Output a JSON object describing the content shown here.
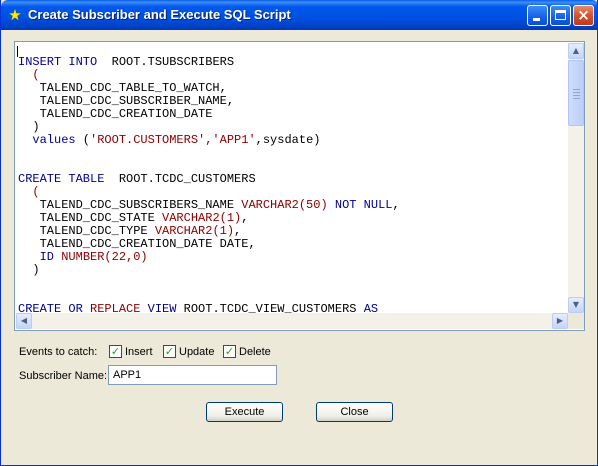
{
  "window": {
    "title": "Create Subscriber and Execute SQL Script",
    "icon": "star-icon",
    "controls": {
      "minimize": "minimize-icon",
      "maximize": "maximize-icon",
      "close": "×"
    }
  },
  "sql_script": {
    "lines": [
      [
        {
          "t": "INSERT INTO",
          "c": "kw"
        },
        {
          "t": "  ROOT.TSUBSCRIBERS"
        }
      ],
      [
        {
          "t": "  (",
          "c": "ty"
        }
      ],
      [
        {
          "t": "   TALEND_CDC_TABLE_TO_WATCH,"
        }
      ],
      [
        {
          "t": "   TALEND_CDC_SUBSCRIBER_NAME,"
        }
      ],
      [
        {
          "t": "   TALEND_CDC_CREATION_DATE"
        }
      ],
      [
        {
          "t": "  )"
        }
      ],
      [
        {
          "t": "  values",
          "c": "kw"
        },
        {
          "t": " ("
        },
        {
          "t": "'ROOT.CUSTOMERS','APP1'",
          "c": "ty"
        },
        {
          "t": ",sysdate)"
        }
      ],
      [],
      [],
      [
        {
          "t": "CREATE TABLE",
          "c": "kw"
        },
        {
          "t": "  ROOT.TCDC_CUSTOMERS"
        }
      ],
      [
        {
          "t": "  (",
          "c": "ty"
        }
      ],
      [
        {
          "t": "   TALEND_CDC_SUBSCRIBERS_NAME "
        },
        {
          "t": "VARCHAR2(50)",
          "c": "ty"
        },
        {
          "t": " "
        },
        {
          "t": "NOT NULL",
          "c": "kw"
        },
        {
          "t": ","
        }
      ],
      [
        {
          "t": "   TALEND_CDC_STATE "
        },
        {
          "t": "VARCHAR2(1)",
          "c": "ty"
        },
        {
          "t": ","
        }
      ],
      [
        {
          "t": "   TALEND_CDC_TYPE "
        },
        {
          "t": "VARCHAR2(1)",
          "c": "ty"
        },
        {
          "t": ","
        }
      ],
      [
        {
          "t": "   TALEND_CDC_CREATION_DATE DATE,"
        }
      ],
      [
        {
          "t": "   ID",
          "c": "kw"
        },
        {
          "t": " "
        },
        {
          "t": "NUMBER(22,0)",
          "c": "ty"
        }
      ],
      [
        {
          "t": "  )"
        }
      ],
      [],
      [],
      [
        {
          "t": "CREATE OR",
          "c": "kw"
        },
        {
          "t": " "
        },
        {
          "t": "REPLACE",
          "c": "ty"
        },
        {
          "t": " "
        },
        {
          "t": "VIEW",
          "c": "kw"
        },
        {
          "t": " ROOT.TCDC_VIEW_CUSTOMERS "
        },
        {
          "t": "AS",
          "c": "kw"
        }
      ]
    ]
  },
  "scrollbars": {
    "up": "▲",
    "down": "▼",
    "left": "◀",
    "right": "▶"
  },
  "events": {
    "label": "Events to catch:",
    "options": [
      {
        "label": "Insert",
        "checked": true
      },
      {
        "label": "Update",
        "checked": true
      },
      {
        "label": "Delete",
        "checked": true
      }
    ],
    "check_glyph": "✓"
  },
  "subscriber": {
    "label": "Subscriber Name:",
    "value": "APP1"
  },
  "buttons": {
    "execute": "Execute",
    "close": "Close"
  }
}
